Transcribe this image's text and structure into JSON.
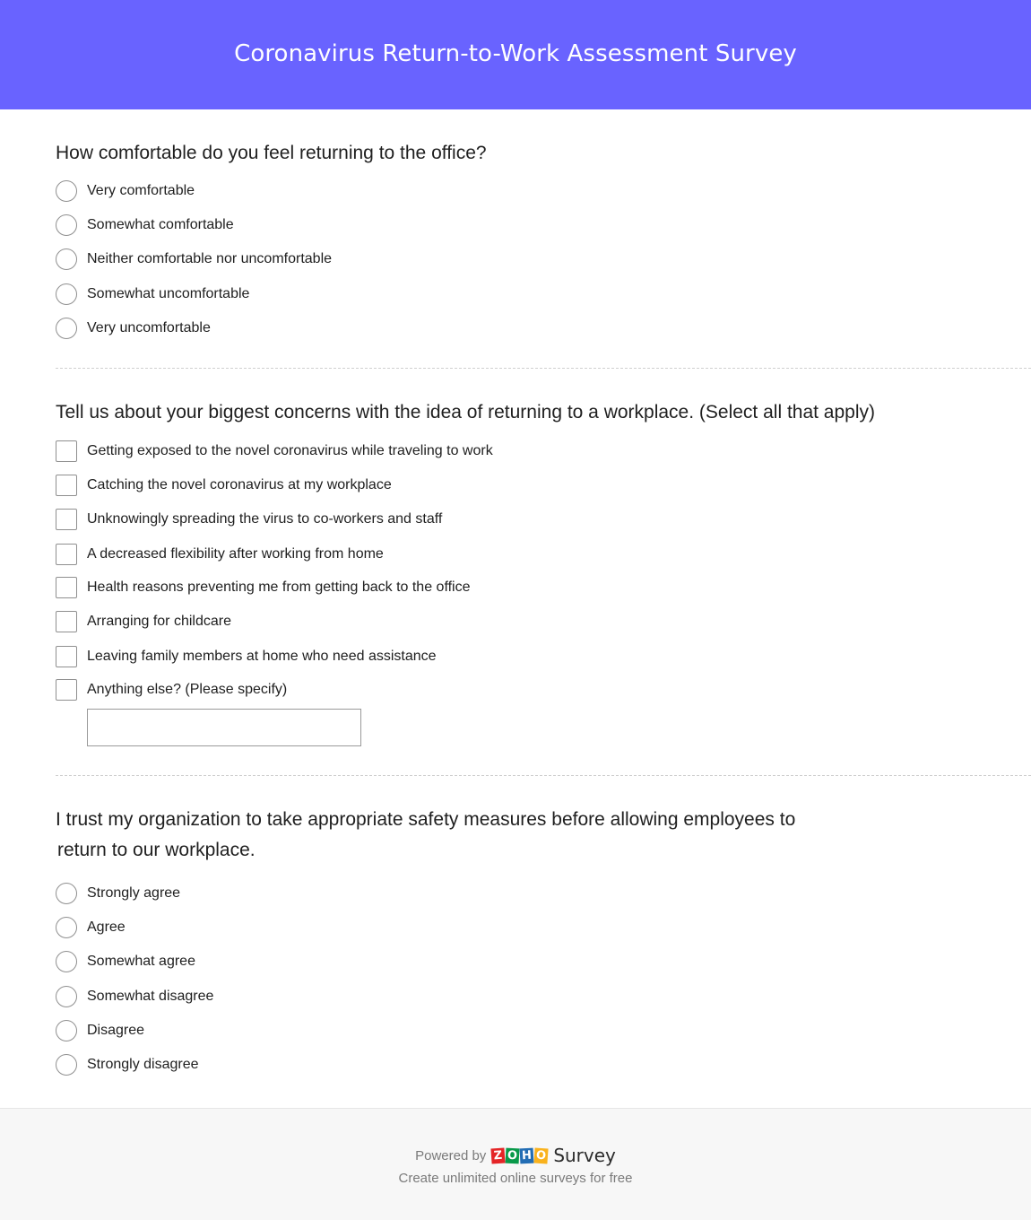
{
  "header": {
    "title": "Coronavirus Return-to-Work Assessment Survey",
    "background_color": "#6963ff"
  },
  "questions": [
    {
      "type": "radio",
      "title": "How comfortable do you feel returning to the office?",
      "options": [
        "Very comfortable",
        "Somewhat comfortable",
        "Neither comfortable nor uncomfortable",
        "Somewhat uncomfortable",
        "Very uncomfortable"
      ]
    },
    {
      "type": "checkbox",
      "title": "Tell us about your biggest concerns with the idea of returning to a workplace. (Select all that apply)",
      "options": [
        "Getting exposed to the novel coronavirus while traveling to work",
        "Catching the novel coronavirus at my workplace",
        "Unknowingly spreading the virus to co-workers and staff",
        "A decreased flexibility after working from home",
        "Health reasons preventing me from getting back to the office",
        "Arranging for childcare",
        "Leaving family members at home who need assistance",
        "Anything else? (Please specify)"
      ],
      "other_input": {
        "value": "",
        "placeholder": ""
      }
    },
    {
      "type": "radio",
      "title_line1": "I trust my organization to take appropriate safety measures before allowing employees to",
      "title_line2": "return to our workplace.",
      "options": [
        "Strongly agree",
        "Agree",
        "Somewhat agree",
        "Somewhat disagree",
        "Disagree",
        "Strongly disagree"
      ]
    }
  ],
  "footer": {
    "powered_by": "Powered by",
    "logo_letters": [
      "Z",
      "O",
      "H",
      "O"
    ],
    "product": "Survey",
    "tagline": "Create unlimited online surveys for free"
  }
}
